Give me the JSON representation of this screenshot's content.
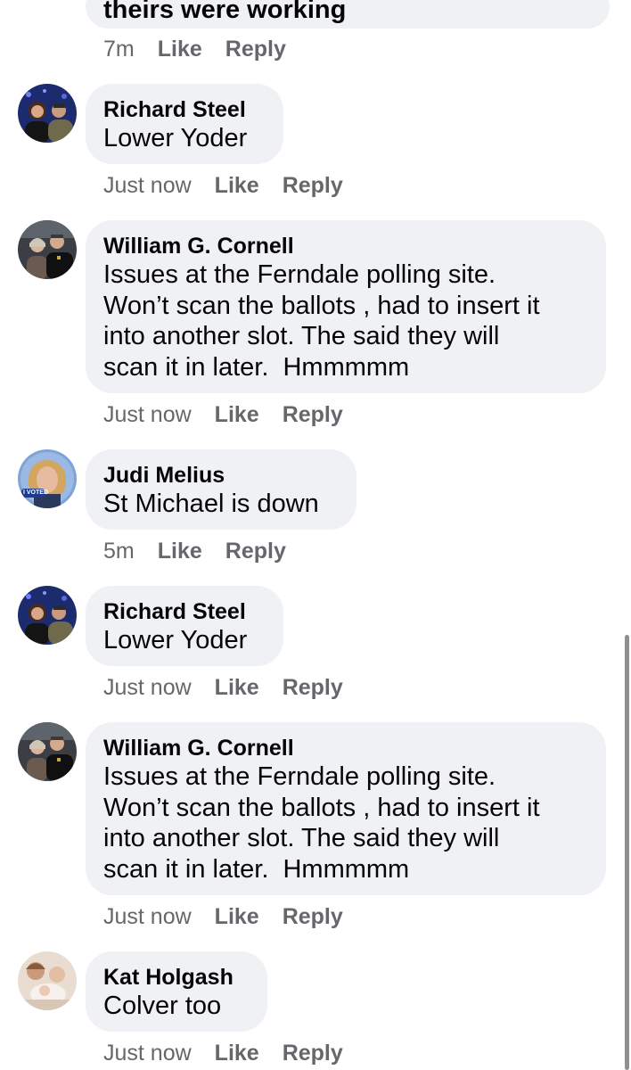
{
  "partial_comment": {
    "text": "theirs were working",
    "time": "7m",
    "like": "Like",
    "reply": "Reply"
  },
  "comments": [
    {
      "name": "Richard Steel",
      "text": "Lower Yoder",
      "time": "Just now",
      "like": "Like",
      "reply": "Reply"
    },
    {
      "name": "William G. Cornell",
      "text": "Issues at the Ferndale polling site.\nWon’t scan the ballots , had to insert it\ninto another slot. The said they will\nscan it in later.  Hmmmmm",
      "time": "Just now",
      "like": "Like",
      "reply": "Reply"
    },
    {
      "name": "Judi Melius",
      "text": "St Michael is down",
      "time": "5m",
      "like": "Like",
      "reply": "Reply",
      "avatar_badge": "I VOTED"
    },
    {
      "name": "Richard Steel",
      "text": "Lower Yoder",
      "time": "Just now",
      "like": "Like",
      "reply": "Reply"
    },
    {
      "name": "William G. Cornell",
      "text": "Issues at the Ferndale polling site.\nWon’t scan the ballots , had to insert it\ninto another slot. The said they will\nscan it in later.  Hmmmmm",
      "time": "Just now",
      "like": "Like",
      "reply": "Reply"
    },
    {
      "name": "Kat Holgash",
      "text": "Colver too",
      "time": "Just now",
      "like": "Like",
      "reply": "Reply"
    }
  ]
}
